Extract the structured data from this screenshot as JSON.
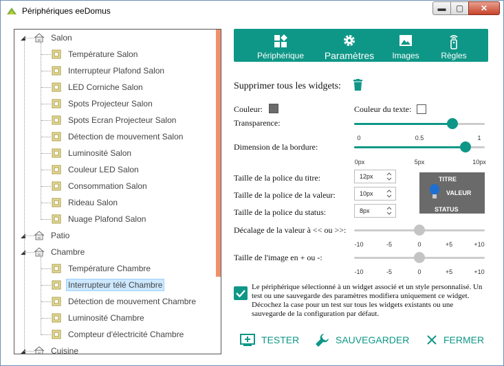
{
  "window": {
    "title": "Périphériques eeDomus",
    "min": "▬",
    "max": "▢",
    "close": "✕"
  },
  "tree": {
    "rooms": [
      {
        "label": "Salon",
        "items": [
          "Température Salon",
          "Interrupteur Plafond Salon",
          "LED Corniche Salon",
          "Spots Projecteur Salon",
          "Spots Ecran Projecteur Salon",
          "Détection de mouvement Salon",
          "Luminosité Salon",
          "Couleur LED Salon",
          "Consommation Salon",
          "Rideau Salon",
          "Nuage Plafond Salon"
        ]
      },
      {
        "label": "Patio",
        "items": []
      },
      {
        "label": "Chambre",
        "items": [
          "Température Chambre",
          "Interrupteur télé Chambre",
          "Détection de mouvement Chambre",
          "Luminosité Chambre",
          "Compteur d'électricité Chambre"
        ]
      },
      {
        "label": "Cuisine",
        "items": []
      }
    ],
    "selected": "Interrupteur télé Chambre"
  },
  "tabs": [
    {
      "label": "Périphérique",
      "icon": "widgets-icon"
    },
    {
      "label": "Paramètres",
      "icon": "gear-icon",
      "active": true
    },
    {
      "label": "Images",
      "icon": "image-icon"
    },
    {
      "label": "Règles",
      "icon": "remote-icon"
    }
  ],
  "settings": {
    "delete_all_label": "Supprimer tous les widgets:",
    "color_label": "Couleur:",
    "color_value": "#6b6b6b",
    "text_color_label": "Couleur du texte:",
    "text_color_value": "#ffffff",
    "transparency_label": "Transparence:",
    "transparency_value": 0.75,
    "transparency_ticks": [
      "0",
      "0.5",
      "1"
    ],
    "border_label": "Dimension de la bordure:",
    "border_value": 8.5,
    "border_ticks": [
      "0px",
      "5px",
      "10px"
    ],
    "title_font_label": "Taille de la police du titre:",
    "title_font_value": "12px",
    "value_font_label": "Taille de la police de la valeur:",
    "value_font_value": "10px",
    "status_font_label": "Taille de la police du status:",
    "status_font_value": "8px",
    "offset_label": "Décalage de la valeur à << ou >>:",
    "offset_value": 0,
    "image_size_label": "Taille de l'image en + ou -:",
    "image_size_value": 0,
    "range_ticks": [
      "-10",
      "-5",
      "0",
      "+5",
      "+10"
    ],
    "preview": {
      "title": "TITRE",
      "value": "VALEUR",
      "status": "STATUS"
    },
    "checkbox_checked": true,
    "checkbox_text": "Le périphérique sélectionné à un widget associé et un style personnalisé. Un test ou une sauvegarde des paramètres modifiera uniquement ce widget. Décochez la case pour un test sur tous les widgets existants ou une sauvegarde de la configuration par défaut."
  },
  "actions": {
    "test": "TESTER",
    "save": "SAUVEGARDER",
    "close": "FERMER"
  },
  "colors": {
    "accent": "#0e9787"
  }
}
